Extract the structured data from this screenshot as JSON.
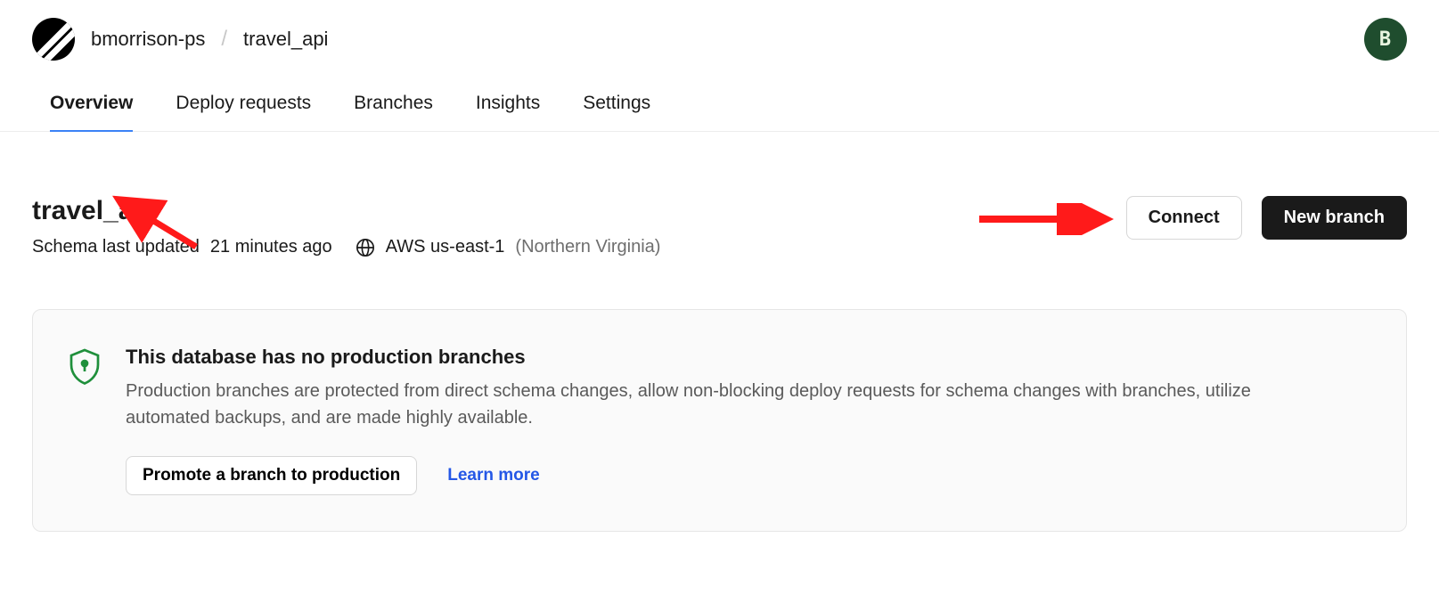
{
  "header": {
    "org": "bmorrison-ps",
    "project": "travel_api",
    "avatar_letter": "B"
  },
  "tabs": [
    {
      "label": "Overview",
      "active": true
    },
    {
      "label": "Deploy requests",
      "active": false
    },
    {
      "label": "Branches",
      "active": false
    },
    {
      "label": "Insights",
      "active": false
    },
    {
      "label": "Settings",
      "active": false
    }
  ],
  "page": {
    "title": "travel_api",
    "schema_updated_prefix": "Schema last updated ",
    "schema_updated_time": "21 minutes ago",
    "region_code": "AWS us-east-1",
    "region_name": "(Northern Virginia)"
  },
  "buttons": {
    "connect": "Connect",
    "new_branch": "New branch"
  },
  "notice": {
    "title": "This database has no production branches",
    "description": "Production branches are protected from direct schema changes, allow non-blocking deploy requests for schema changes with branches, utilize automated backups, and are made highly available.",
    "promote": "Promote a branch to production",
    "learn_more": "Learn more"
  }
}
